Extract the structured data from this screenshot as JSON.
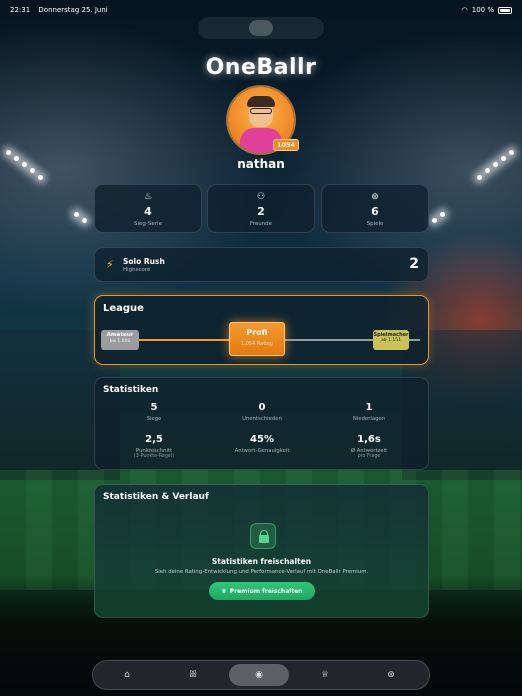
{
  "status_bar": {
    "time": "22:31",
    "date": "Donnerstag 25. Juni",
    "wifi_icon": "wifi-icon",
    "battery": "100 %"
  },
  "app": {
    "logo_text": "OneBallr"
  },
  "profile": {
    "username": "nathan",
    "rating_badge": "1054"
  },
  "quick_stats": [
    {
      "icon": "flame-icon",
      "value": "4",
      "label": "Sieg-Serie"
    },
    {
      "icon": "friends-icon",
      "value": "2",
      "label": "Freunde"
    },
    {
      "icon": "ball-icon",
      "value": "6",
      "label": "Spiele"
    }
  ],
  "solo_rush": {
    "title": "Solo Rush",
    "subtitle": "Highscore",
    "value": "2"
  },
  "league": {
    "title": "League",
    "progress_fraction": 0.54,
    "tiers": [
      {
        "name": "Amateur",
        "sub": "bis 1.000"
      },
      {
        "name": "Profi",
        "sub": "1.054 Rating",
        "current": true
      },
      {
        "name": "Spielmacher",
        "sub": "ab 1.151"
      }
    ]
  },
  "statistics": {
    "title": "Statistiken",
    "row1": [
      {
        "value": "5",
        "label": "Siege"
      },
      {
        "value": "0",
        "label": "Unentschieden"
      },
      {
        "value": "1",
        "label": "Niederlagen"
      }
    ],
    "row2": [
      {
        "value": "2,5",
        "label": "Punkteschnitt",
        "sub": "(3-Punkte-Regel)"
      },
      {
        "value": "45%",
        "label": "Antwort-Genauigkeit"
      },
      {
        "value": "1,6s",
        "label": "Ø Antwortzeit",
        "sub": "pro Frage"
      }
    ]
  },
  "history": {
    "title": "Statistiken & Verlauf",
    "unlock_heading": "Statistiken freischalten",
    "unlock_text": "Sieh deine Rating-Entwicklung und Performance-Verlauf mit OneBallr Premium.",
    "button_label": "Premium freischalten",
    "button_icon": "crown-icon"
  },
  "tabbar": [
    {
      "name": "home",
      "icon": "home-icon",
      "glyph": "⌂"
    },
    {
      "name": "community",
      "icon": "group-icon",
      "glyph": "ꕥ"
    },
    {
      "name": "profile",
      "icon": "profile-icon",
      "glyph": "◉",
      "active": true
    },
    {
      "name": "trophies",
      "icon": "trophy-icon",
      "glyph": "♕"
    },
    {
      "name": "play",
      "icon": "ball-icon",
      "glyph": "⊛"
    }
  ],
  "colors": {
    "accent_orange": "#f59a2e",
    "premium_green": "#2fc77a",
    "card_bg": "#0e202c"
  }
}
